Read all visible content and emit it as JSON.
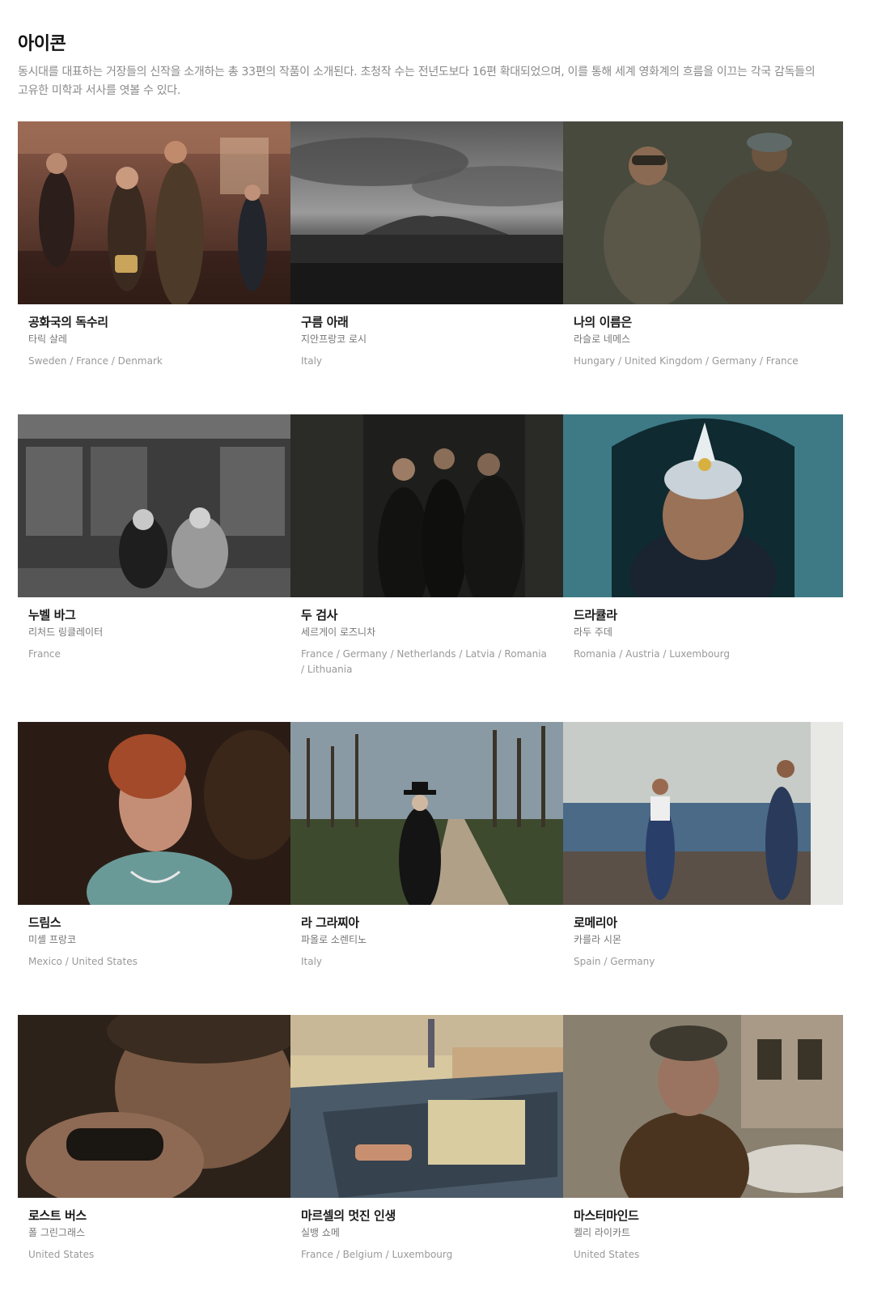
{
  "section": {
    "title": "아이콘",
    "description": "동시대를 대표하는 거장들의 신작을 소개하는 총 33편의 작품이 소개된다. 초청작 수는 전년도보다 16편 확대되었으며, 이를 통해 세계 영화계의 흐름을 이끄는 각국 감독들의 고유한 미학과 서사를 엿볼 수 있다."
  },
  "films": [
    {
      "title": "공화국의 독수리",
      "director": "타릭 살레",
      "countries": "Sweden / France / Denmark",
      "image": "film-still-party-scene"
    },
    {
      "title": "구름 아래",
      "director": "지안프랑코 로시",
      "countries": "Italy",
      "image": "film-still-volcano-landscape"
    },
    {
      "title": "나의 이름은",
      "director": "라슬로 네메스",
      "countries": "Hungary / United Kingdom / Germany / France",
      "image": "film-still-boy-goggles"
    },
    {
      "title": "누벨 바그",
      "director": "리처드 링클레이터",
      "countries": "France",
      "image": "film-still-cafe-bw"
    },
    {
      "title": "두 검사",
      "director": "세르게이 로즈니차",
      "countries": "France / Germany / Netherlands / Latvia / Romania / Lithuania",
      "image": "film-still-officers-corridor"
    },
    {
      "title": "드라큘라",
      "director": "라두 주데",
      "countries": "Romania / Austria / Luxembourg",
      "image": "film-still-man-feather-hat"
    },
    {
      "title": "드림스",
      "director": "미셸 프랑코",
      "countries": "Mexico / United States",
      "image": "film-still-woman-necklace"
    },
    {
      "title": "라 그라찌아",
      "director": "파올로 소렌티노",
      "countries": "Italy",
      "image": "film-still-man-road-trees"
    },
    {
      "title": "로메리아",
      "director": "카를라 시몬",
      "countries": "Spain / Germany",
      "image": "film-still-seaside-women"
    },
    {
      "title": "로스트 버스",
      "director": "폴 그린그래스",
      "countries": "United States",
      "image": "film-still-man-closeup"
    },
    {
      "title": "마르셀의 멋진 인생",
      "director": "실뱅 쇼메",
      "countries": "France / Belgium / Luxembourg",
      "image": "film-still-animated-paris-rooftop"
    },
    {
      "title": "마스터마인드",
      "director": "켈리 라이카트",
      "countries": "United States",
      "image": "film-still-man-flat-cap"
    }
  ]
}
